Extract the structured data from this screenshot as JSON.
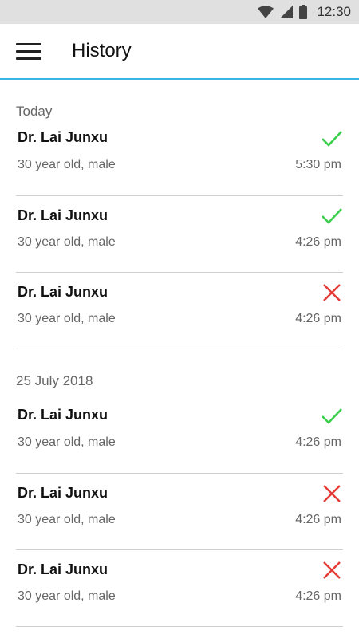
{
  "status_bar": {
    "time": "12:30"
  },
  "header": {
    "title": "History"
  },
  "sections": [
    {
      "label": "Today",
      "items": [
        {
          "name": "Dr. Lai Junxu",
          "desc": "30 year old, male",
          "time": "5:30 pm",
          "status": "check-icon"
        },
        {
          "name": "Dr. Lai Junxu",
          "desc": "30 year old, male",
          "time": "4:26 pm",
          "status": "check-icon"
        },
        {
          "name": "Dr. Lai Junxu",
          "desc": "30 year old, male",
          "time": "4:26 pm",
          "status": "cross-icon"
        }
      ]
    },
    {
      "label": "25 July 2018",
      "items": [
        {
          "name": "Dr. Lai Junxu",
          "desc": "30 year old, male",
          "time": "4:26 pm",
          "status": "check-icon"
        },
        {
          "name": "Dr. Lai Junxu",
          "desc": "30 year old, male",
          "time": "4:26 pm",
          "status": "cross-icon"
        },
        {
          "name": "Dr. Lai Junxu",
          "desc": "30 year old, male",
          "time": "4:26 pm",
          "status": "cross-icon"
        }
      ]
    }
  ],
  "colors": {
    "accent": "#38b6e3",
    "success": "#3ccf4e",
    "error": "#e53935"
  }
}
